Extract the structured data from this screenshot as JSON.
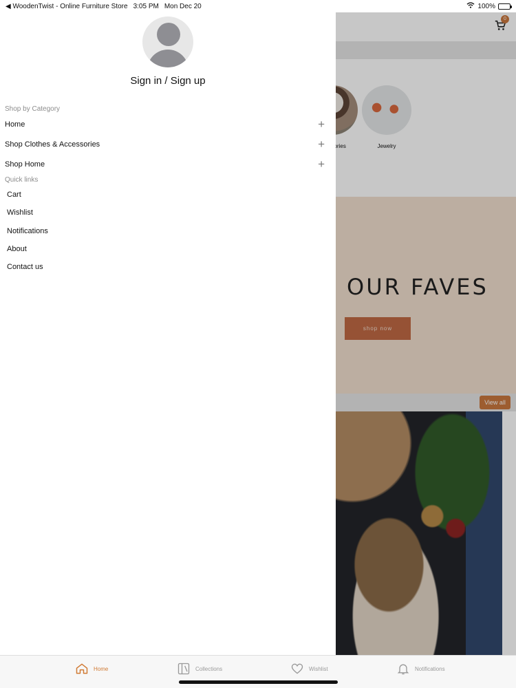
{
  "status_bar": {
    "back_app": "WoodenTwist - Online Furniture Store",
    "time": "3:05 PM",
    "date": "Mon Dec 20",
    "battery": "100%"
  },
  "background_app": {
    "cart_count": "0",
    "categories": [
      {
        "label": "ccessories"
      },
      {
        "label": "Jewelry"
      }
    ],
    "hero": {
      "title": "OUR FAVES",
      "button": "shop now"
    },
    "view_all": "View all"
  },
  "drawer": {
    "signin_label": "Sign in / Sign up",
    "shop_by_category_label": "Shop by Category",
    "categories": [
      {
        "label": "Home"
      },
      {
        "label": "Shop Clothes & Accessories"
      },
      {
        "label": "Shop Home"
      }
    ],
    "quick_links_label": "Quick links",
    "quick_links": [
      {
        "label": "Cart"
      },
      {
        "label": "Wishlist"
      },
      {
        "label": "Notifications"
      },
      {
        "label": "About"
      },
      {
        "label": "Contact us"
      }
    ]
  },
  "tab_bar": {
    "tabs": [
      {
        "label": "Home",
        "icon": "home-icon",
        "active": true
      },
      {
        "label": "Collections",
        "icon": "collections-icon",
        "active": false
      },
      {
        "label": "Wishlist",
        "icon": "heart-icon",
        "active": false
      },
      {
        "label": "Notifications",
        "icon": "bell-icon",
        "active": false
      }
    ]
  },
  "colors": {
    "accent": "#d07a34",
    "overlay": "#000000",
    "hero_background": "#f1dfcf"
  }
}
